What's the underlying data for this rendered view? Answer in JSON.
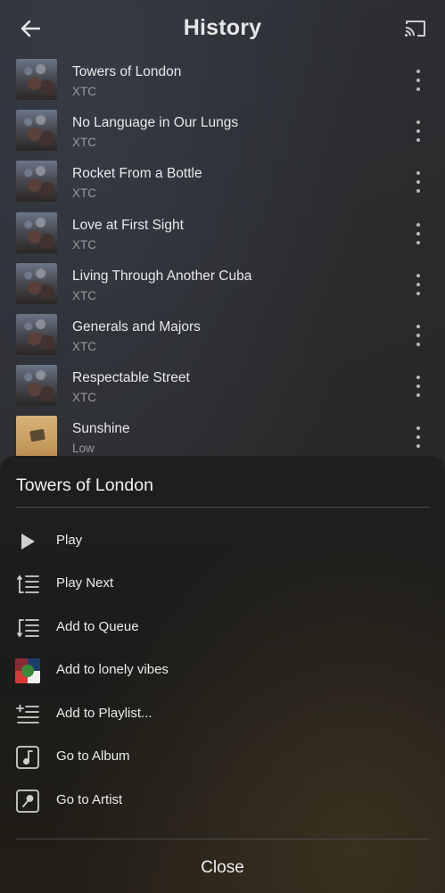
{
  "header": {
    "title": "History",
    "back_icon": "arrow-left-icon",
    "cast_icon": "cast-icon"
  },
  "history": [
    {
      "title": "Towers of London",
      "artist": "XTC",
      "art": "xtc"
    },
    {
      "title": "No Language in Our Lungs",
      "artist": "XTC",
      "art": "xtc"
    },
    {
      "title": "Rocket From a Bottle",
      "artist": "XTC",
      "art": "xtc"
    },
    {
      "title": "Love at First Sight",
      "artist": "XTC",
      "art": "xtc"
    },
    {
      "title": "Living Through Another Cuba",
      "artist": "XTC",
      "art": "xtc"
    },
    {
      "title": "Generals and Majors",
      "artist": "XTC",
      "art": "xtc"
    },
    {
      "title": "Respectable Street",
      "artist": "XTC",
      "art": "xtc"
    },
    {
      "title": "Sunshine",
      "artist": "Low",
      "art": "sunshine"
    }
  ],
  "sheet": {
    "title": "Towers of London",
    "items": [
      {
        "label": "Play",
        "icon": "play-icon"
      },
      {
        "label": "Play Next",
        "icon": "play-next-icon"
      },
      {
        "label": "Add to Queue",
        "icon": "add-to-queue-icon"
      },
      {
        "label": "Add to lonely vibes",
        "icon": "playlist-art-icon"
      },
      {
        "label": "Add to Playlist...",
        "icon": "add-to-playlist-icon"
      },
      {
        "label": "Go to Album",
        "icon": "album-icon"
      },
      {
        "label": "Go to Artist",
        "icon": "artist-icon"
      }
    ],
    "close_label": "Close"
  },
  "colors": {
    "text_primary": "#e9e9e9",
    "text_secondary": "#9a9a9a",
    "divider": "#4a4a4a"
  }
}
